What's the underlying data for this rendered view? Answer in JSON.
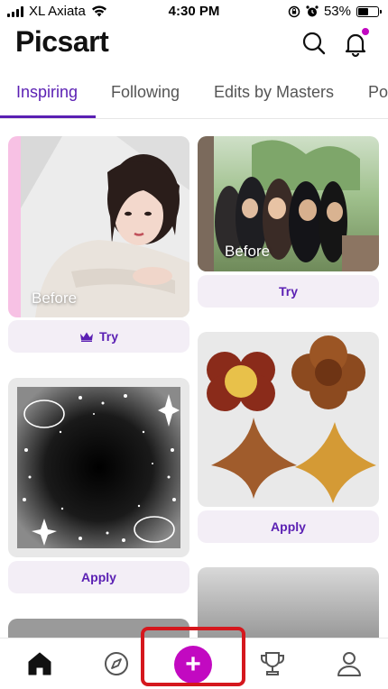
{
  "status_bar": {
    "carrier": "XL Axiata",
    "time": "4:30 PM",
    "battery": "53%"
  },
  "header": {
    "logo": "Picsart",
    "search_icon": "search-icon",
    "bell_icon": "bell-icon",
    "notif_color": "#C209C1"
  },
  "tabs": [
    {
      "label": "Inspiring",
      "active": true
    },
    {
      "label": "Following",
      "active": false
    },
    {
      "label": "Edits by Masters",
      "active": false
    },
    {
      "label": "Po",
      "active": false
    }
  ],
  "feed": {
    "left": [
      {
        "kind": "portrait",
        "before_label": "Before",
        "button_label": "Try",
        "premium": true
      },
      {
        "kind": "sparkle-frame",
        "button_label": "Apply"
      }
    ],
    "right": [
      {
        "kind": "group-photo",
        "before_label": "Before",
        "button_label": "Try"
      },
      {
        "kind": "cookie-stickers",
        "button_label": "Apply"
      }
    ]
  },
  "bottom_nav": {
    "items": [
      "home-icon",
      "explore-icon",
      "create-plus-icon",
      "challenges-trophy-icon",
      "profile-icon"
    ],
    "plus_label": "+",
    "accent": "#C209C1"
  },
  "colors": {
    "brand_purple": "#5A1FB3",
    "button_bg": "#F3EEF6",
    "highlight_red": "#D5171D"
  }
}
